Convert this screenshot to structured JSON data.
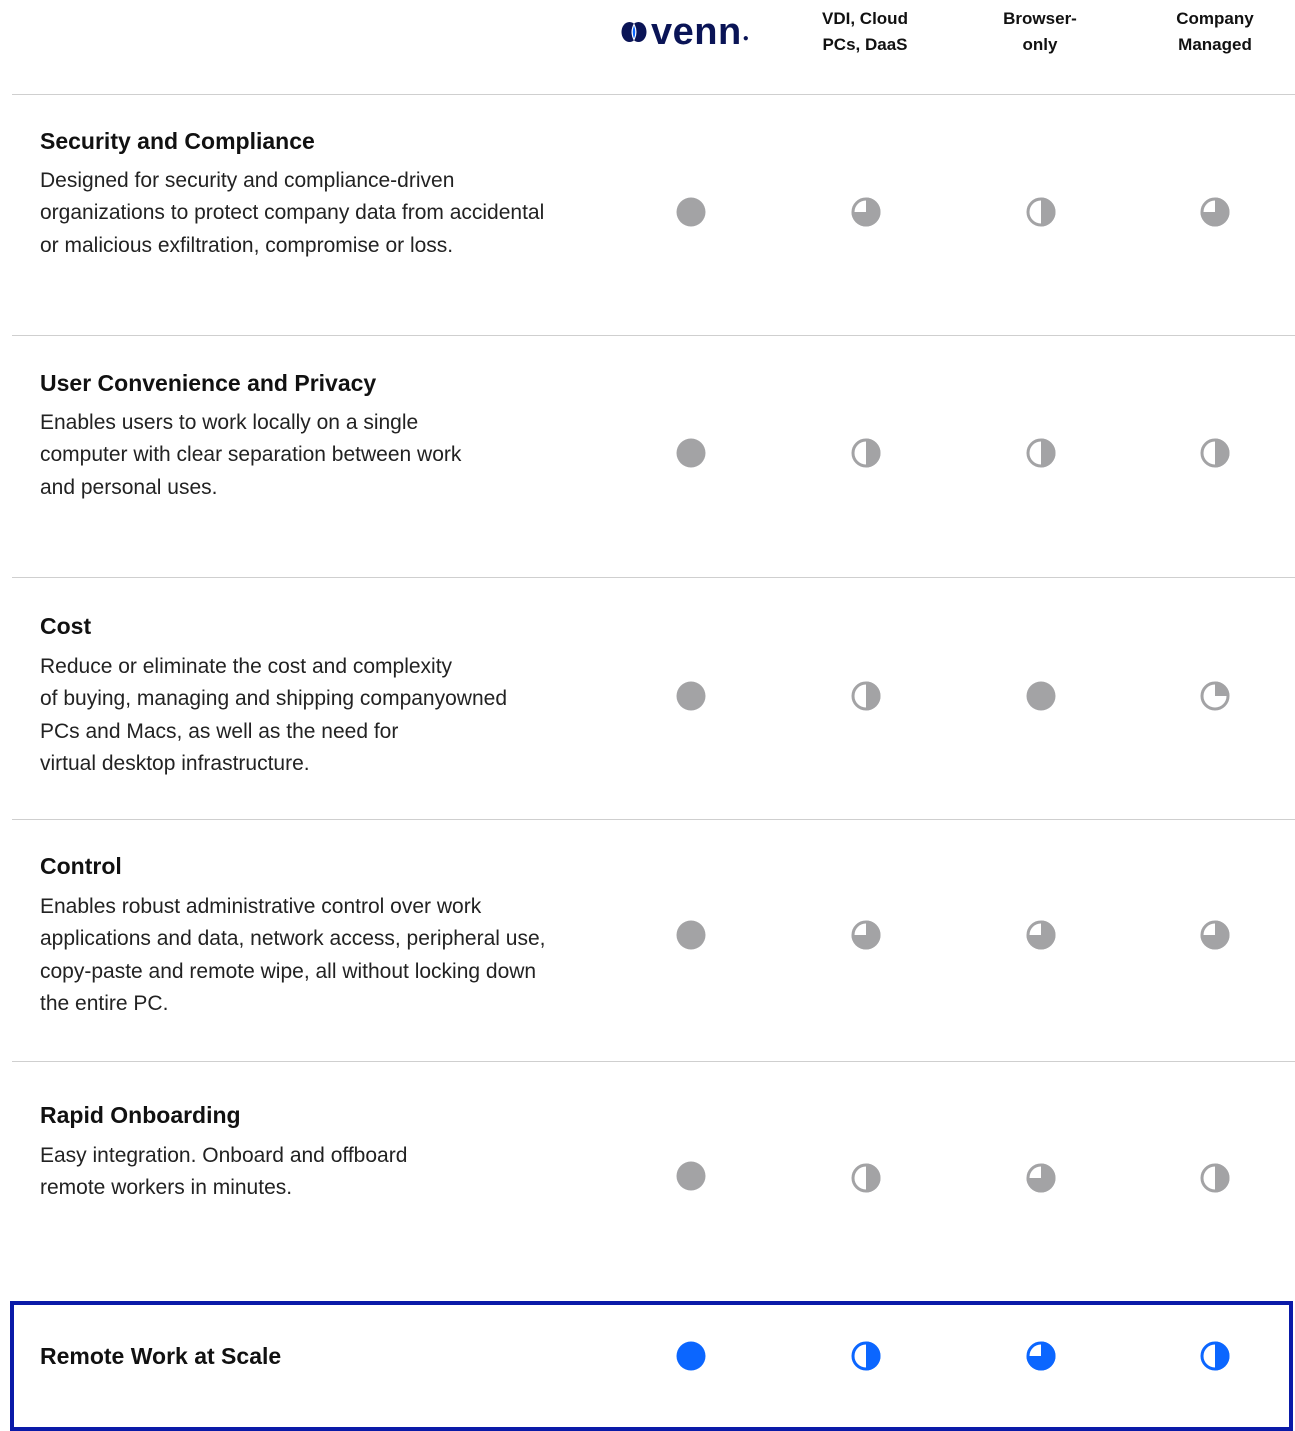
{
  "logo": {
    "text": "venn",
    "color": "#0a1456"
  },
  "columns": [
    {
      "id": "venn",
      "label": ""
    },
    {
      "id": "vdi",
      "label": "VDI, Cloud PCs, DaaS"
    },
    {
      "id": "browser",
      "label": "Browser-only"
    },
    {
      "id": "managed",
      "label": "Company Managed"
    }
  ],
  "header_labels": {
    "vdi": [
      "VDI, Cloud",
      "PCs, DaaS"
    ],
    "browser": [
      "Browser-",
      "only"
    ],
    "managed": [
      "Company",
      "Managed"
    ]
  },
  "colors": {
    "rating_gray": "#a3a3a5",
    "rating_blue": "#0b66ff",
    "highlight_border": "#0a1aa8",
    "separator": "#cfcfcf"
  },
  "rows": [
    {
      "title": "Security and Compliance",
      "description": "Designed for security and compliance-driven\norganizations to protect company data from accidental\nor malicious exfiltration, compromise or loss.",
      "ratings": [
        1.0,
        0.75,
        0.5,
        0.75
      ],
      "color": "gray"
    },
    {
      "title": "User Convenience and Privacy",
      "description": "Enables users to work locally on a single\ncomputer with clear separation between work\nand personal uses.",
      "ratings": [
        1.0,
        0.5,
        0.5,
        0.5
      ],
      "color": "gray"
    },
    {
      "title": "Cost",
      "description": "Reduce or eliminate the cost and complexity\nof buying, managing and shipping companyowned\nPCs and Macs, as well as the need for\nvirtual desktop infrastructure.",
      "ratings": [
        1.0,
        0.5,
        1.0,
        0.25
      ],
      "color": "gray"
    },
    {
      "title": "Control",
      "description": "Enables robust administrative control over work\napplications and data, network access, peripheral use,\ncopy-paste and remote wipe, all without locking down\nthe entire PC.",
      "ratings": [
        1.0,
        0.75,
        0.75,
        0.75
      ],
      "color": "gray"
    },
    {
      "title": "Rapid Onboarding",
      "description": "Easy integration. Onboard and offboard\nremote workers in minutes.",
      "ratings": [
        1.0,
        0.5,
        0.75,
        0.5
      ],
      "color": "gray"
    }
  ],
  "summary_row": {
    "title": "Remote Work at Scale",
    "ratings": [
      1.0,
      0.5,
      0.75,
      0.5
    ],
    "color": "blue"
  }
}
